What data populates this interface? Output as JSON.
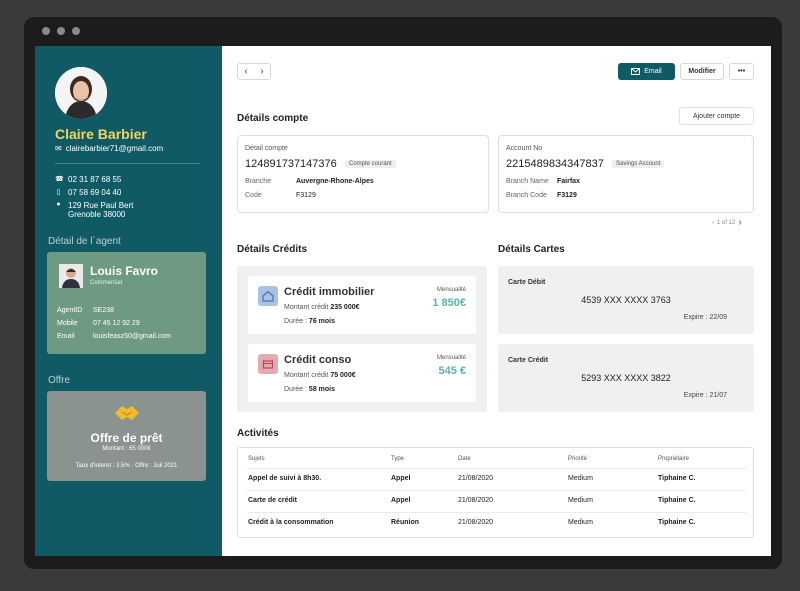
{
  "profile": {
    "name": "Claire Barbier",
    "email": "clairebarbier71@gmail.com",
    "phone1": "02 31 87 68 55",
    "phone2": "07 58 69 04 40",
    "address_line1": "129 Rue Paul Bert",
    "address_line2": "Grenoble 38000"
  },
  "agent": {
    "section_title": "Détail de l´agent",
    "name": "Louis Favro",
    "role": "Commercial",
    "id_label": "AgentID",
    "id_value": "SE238",
    "mobile_label": "Mobile",
    "mobile_value": "07 45 12 92 29",
    "email_label": "Email",
    "email_value": "louisfeasz50@gmail.com"
  },
  "offer": {
    "section_title": "Offre",
    "title": "Offre de prêt",
    "amount": "Montant : 65 000€",
    "rate": "Taux d'interet : 3.5%",
    "date": "Offre : Juil 2021"
  },
  "toolbar": {
    "email_label": "Email",
    "modify_label": "Modifier",
    "more_label": "•••"
  },
  "accounts": {
    "title": "Détails compte",
    "add_label": "Ajouter compte",
    "card1": {
      "label": "Détail compte",
      "number": "124891737147376",
      "badge": "Compte courant",
      "k1": "Branche",
      "v1": "Auvergne-Rhone-Alpes",
      "k2": "Code",
      "v2": "F3129"
    },
    "card2": {
      "label": "Account No",
      "number": "2215489834347837",
      "badge": "Savings Account",
      "k1": "Branch Name",
      "v1": "Fairfax",
      "k2": "Branch Code",
      "v2": "F3129"
    },
    "pager": "1 of 12"
  },
  "credits": {
    "title": "Détails Crédits",
    "items": [
      {
        "title": "Crédit immobilier",
        "amount_label": "Montant crédit",
        "amount": "235 000€",
        "duration_label": "Durée :",
        "duration": "76 mois",
        "monthly_label": "Mensualité",
        "monthly": "1 850€"
      },
      {
        "title": "Crédit conso",
        "amount_label": "Montant crédit",
        "amount": "75 000€",
        "duration_label": "Durée :",
        "duration": "58 mois",
        "monthly_label": "Mensualité",
        "monthly": "545 €"
      }
    ]
  },
  "cards": {
    "title": "Détails Cartes",
    "items": [
      {
        "type": "Carte Débit",
        "number": "4539 XXX XXXX 3763",
        "expiry": "Expire : 22/09"
      },
      {
        "type": "Carte Crédit",
        "number": "5293 XXX XXXX 3822",
        "expiry": "Expire : 21/07"
      }
    ]
  },
  "activities": {
    "title": "Activités",
    "headers": [
      "Sujets",
      "Type",
      "Date",
      "Priorité",
      "Propriétaire"
    ],
    "rows": [
      [
        "Appel de suivi à 8h30.",
        "Appel",
        "21/08/2020",
        "Medium",
        "Tiphaine C."
      ],
      [
        "Carte de crédit",
        "Appel",
        "21/08/2020",
        "Medium",
        "Tiphaine C."
      ],
      [
        "Crédit à la consommation",
        "Réunion",
        "21/08/2020",
        "Medium",
        "Tiphaine C."
      ]
    ]
  },
  "colors": {
    "sidebar": "#0f5a64",
    "accent_name": "#f2d560",
    "agent_card": "#6e9a82",
    "monthly": "#5bb2a8"
  }
}
